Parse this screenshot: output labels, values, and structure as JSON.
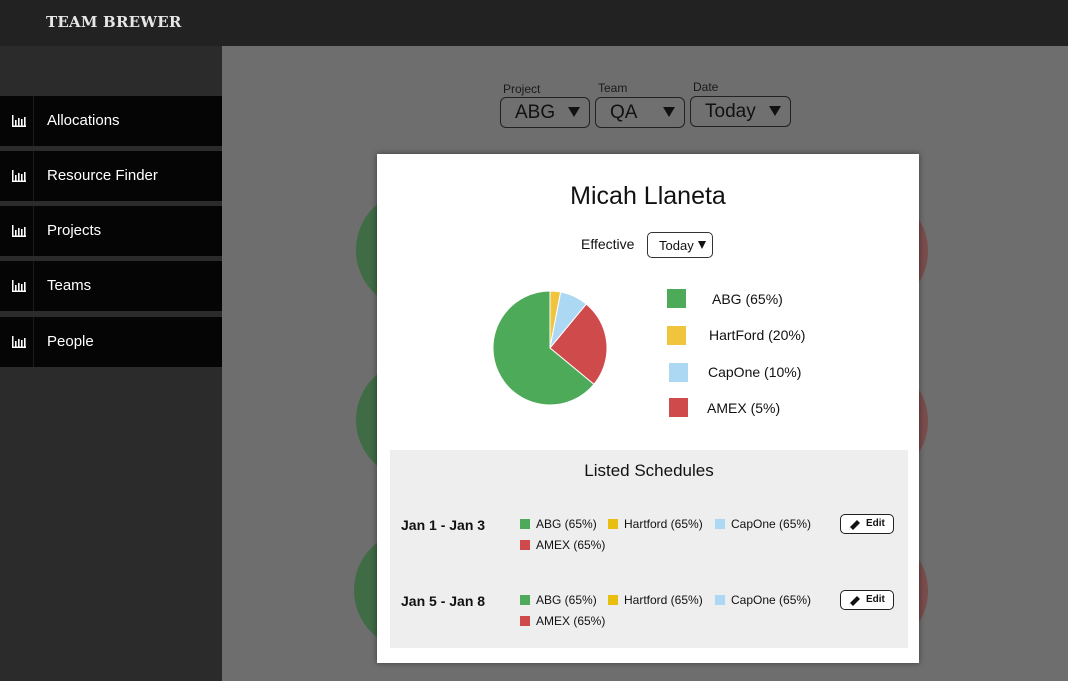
{
  "app": {
    "brand": "TEAM BREWER"
  },
  "sidebar": {
    "items": [
      {
        "label": "Allocations",
        "icon": "bar-chart-icon"
      },
      {
        "label": "Resource Finder",
        "icon": "bar-chart-icon"
      },
      {
        "label": "Projects",
        "icon": "bar-chart-icon"
      },
      {
        "label": "Teams",
        "icon": "bar-chart-icon"
      },
      {
        "label": "People",
        "icon": "bar-chart-icon"
      }
    ]
  },
  "filters": {
    "project": {
      "label": "Project",
      "value": "ABG"
    },
    "team": {
      "label": "Team",
      "value": "QA"
    },
    "date": {
      "label": "Date",
      "value": "Today"
    }
  },
  "modal": {
    "name": "Micah Llaneta",
    "effective_label": "Effective",
    "effective_value": "Today",
    "legend": [
      {
        "label": "ABG (65%)",
        "color": "#4caa58"
      },
      {
        "label": "HartFord (20%)",
        "color": "#f0c43c"
      },
      {
        "label": "CapOne (10%)",
        "color": "#add8f3"
      },
      {
        "label": "AMEX (5%)",
        "color": "#cf4b4b"
      }
    ],
    "schedules": {
      "title": "Listed Schedules",
      "edit_label": "Edit",
      "rows": [
        {
          "range": "Jan 1 - Jan 3",
          "chips": [
            {
              "label": "ABG (65%)",
              "color": "#4caa58"
            },
            {
              "label": "Hartford (65%)",
              "color": "#e8bf10"
            },
            {
              "label": "CapOne (65%)",
              "color": "#add8f3"
            },
            {
              "label": "AMEX (65%)",
              "color": "#cf4b4b"
            }
          ]
        },
        {
          "range": "Jan 5 - Jan 8",
          "chips": [
            {
              "label": "ABG (65%)",
              "color": "#4caa58"
            },
            {
              "label": "Hartford (65%)",
              "color": "#e8bf10"
            },
            {
              "label": "CapOne (65%)",
              "color": "#add8f3"
            },
            {
              "label": "AMEX (65%)",
              "color": "#cf4b4b"
            }
          ]
        }
      ]
    }
  },
  "chart_data": {
    "type": "pie",
    "categories": [
      "Yellow",
      "Blue",
      "Red",
      "Green"
    ],
    "values": [
      3,
      8,
      25,
      64
    ],
    "colors": [
      "#f0c43c",
      "#add8f3",
      "#cf4b4b",
      "#4caa58"
    ],
    "title": ""
  }
}
